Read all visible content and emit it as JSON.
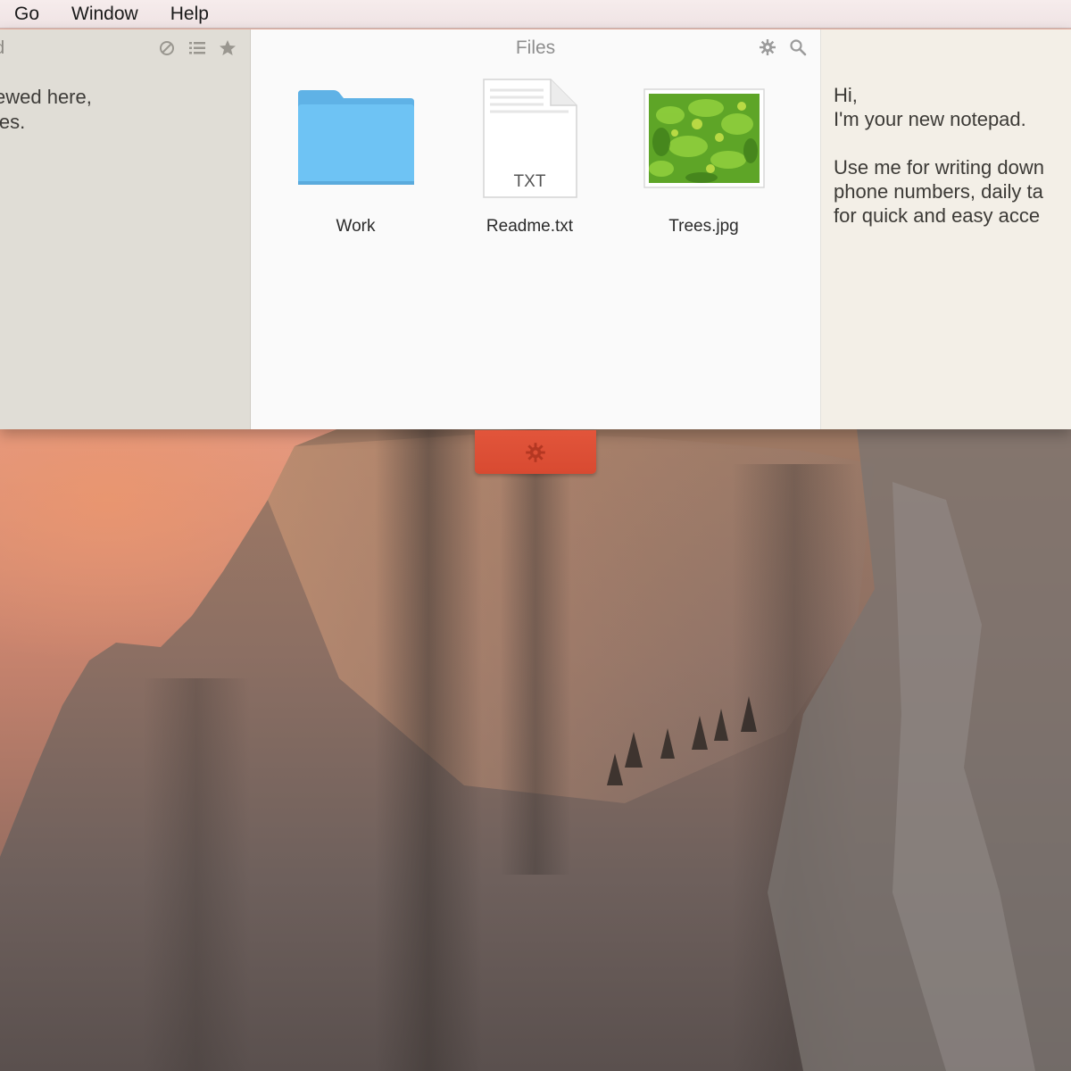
{
  "menubar": {
    "items": [
      {
        "label": "Go"
      },
      {
        "label": "Window"
      },
      {
        "label": "Help"
      }
    ]
  },
  "left_pane": {
    "title": "d",
    "note_text": "ewed here,\nles."
  },
  "files_pane": {
    "title": "Files",
    "items": [
      {
        "name": "Work",
        "kind": "folder",
        "color": "#66bff2"
      },
      {
        "name": "Readme.txt",
        "kind": "text",
        "badge": "TXT"
      },
      {
        "name": "Trees.jpg",
        "kind": "image"
      }
    ]
  },
  "notepad_pane": {
    "note_text": "Hi,\nI'm your new notepad.\n\nUse me for writing down\nphone numbers, daily ta\nfor quick and easy acce"
  },
  "colors": {
    "accent": "#d94c33",
    "folder": "#66bff2"
  },
  "icons": {
    "left_toolbar": [
      "no-entry-icon",
      "list-icon",
      "star-icon"
    ],
    "files_toolbar": [
      "gear-icon",
      "search-icon"
    ],
    "pull_tab": "gear-icon"
  }
}
